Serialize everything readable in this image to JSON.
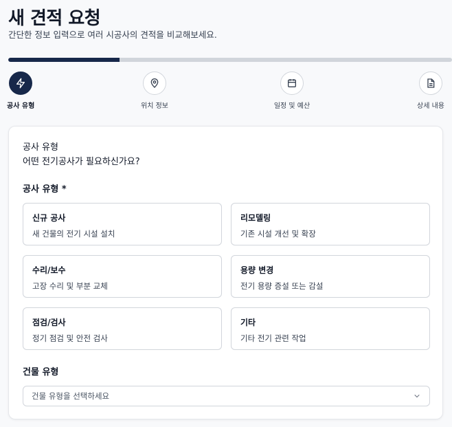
{
  "header": {
    "title": "새 견적 요청",
    "subtitle": "간단한 정보 입력으로 여러 시공사의 견적을 비교해보세요."
  },
  "progress": {
    "current_step": 1,
    "total_steps": 4,
    "fraction": 0.25
  },
  "steps": [
    {
      "label": "공사 유형",
      "icon": "bolt-icon",
      "active": true
    },
    {
      "label": "위치 정보",
      "icon": "map-pin-icon",
      "active": false
    },
    {
      "label": "일정 및 예산",
      "icon": "calendar-icon",
      "active": false
    },
    {
      "label": "상세 내용",
      "icon": "document-icon",
      "active": false
    }
  ],
  "form": {
    "section_title": "공사 유형",
    "section_question": "어떤 전기공사가 필요하신가요?",
    "work_type_label": "공사 유형 *",
    "options": [
      {
        "title": "신규 공사",
        "desc": "새 건물의 전기 시설 설치"
      },
      {
        "title": "리모델링",
        "desc": "기존 시설 개선 및 확장"
      },
      {
        "title": "수리/보수",
        "desc": "고장 수리 및 부분 교체"
      },
      {
        "title": "용량 변경",
        "desc": "전기 용량 증설 또는 감설"
      },
      {
        "title": "점검/검사",
        "desc": "정기 점검 및 안전 검사"
      },
      {
        "title": "기타",
        "desc": "기타 전기 관련 작업"
      }
    ],
    "building_type_label": "건물 유형",
    "building_type_placeholder": "건물 유형을 선택하세요"
  },
  "colors": {
    "primary": "#17284a",
    "border": "#d1d5db",
    "progress_track": "#d1d5db"
  }
}
